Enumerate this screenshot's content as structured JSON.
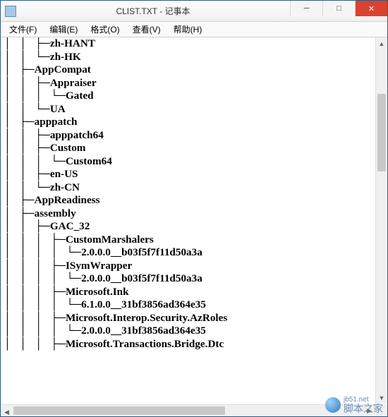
{
  "window": {
    "title": "CLIST.TXT - 记事本",
    "app_name": "记事本",
    "file_name": "CLIST.TXT"
  },
  "menu": {
    "file": "文件(F)",
    "edit": "编辑(E)",
    "format": "格式(O)",
    "view": "查看(V)",
    "help": "帮助(H)"
  },
  "win_buttons": {
    "minimize": "─",
    "maximize": "□",
    "close": "✕"
  },
  "content_lines": [
    "│   │   ├─zh-HANT",
    "│   │   └─zh-HK",
    "│   ├─AppCompat",
    "│   │   ├─Appraiser",
    "│   │   │   └─Gated",
    "│   │   └─UA",
    "│   ├─apppatch",
    "│   │   ├─apppatch64",
    "│   │   ├─Custom",
    "│   │   │   └─Custom64",
    "│   │   ├─en-US",
    "│   │   └─zh-CN",
    "│   ├─AppReadiness",
    "│   ├─assembly",
    "│   │   ├─GAC_32",
    "│   │   │   ├─CustomMarshalers",
    "│   │   │   │   └─2.0.0.0__b03f5f7f11d50a3a",
    "│   │   │   ├─ISymWrapper",
    "│   │   │   │   └─2.0.0.0__b03f5f7f11d50a3a",
    "│   │   │   ├─Microsoft.Ink",
    "│   │   │   │   └─6.1.0.0__31bf3856ad364e35",
    "│   │   │   ├─Microsoft.Interop.Security.AzRoles",
    "│   │   │   │   └─2.0.0.0__31bf3856ad364e35",
    "│   │   │   ├─Microsoft.Transactions.Bridge.Dtc"
  ],
  "watermark": {
    "site": "jb51.net",
    "text": "脚本之家"
  }
}
